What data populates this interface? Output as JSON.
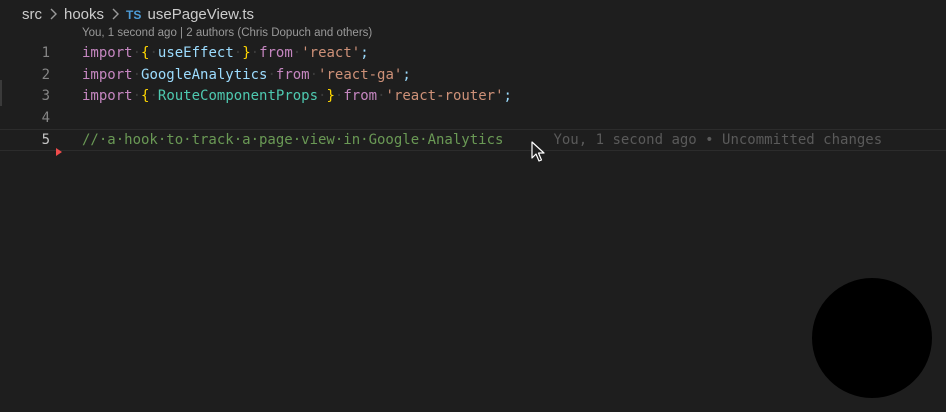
{
  "breadcrumb": {
    "items": [
      "src",
      "hooks"
    ],
    "file_icon": "TS",
    "file_name": "usePageView.ts"
  },
  "codelens": "You, 1 second ago | 2 authors (Chris Dopuch and others)",
  "line_numbers": [
    "1",
    "2",
    "3",
    "4",
    "5"
  ],
  "code": {
    "line1": {
      "kw1": "import",
      "b1": "{",
      "id": "useEffect",
      "b2": "}",
      "kw2": "from",
      "str": "'react'",
      "end": ";"
    },
    "line2": {
      "kw1": "import",
      "id": "GoogleAnalytics",
      "kw2": "from",
      "str": "'react-ga'",
      "end": ";"
    },
    "line3": {
      "kw1": "import",
      "b1": "{",
      "id": "RouteComponentProps",
      "b2": "}",
      "kw2": "from",
      "str": "'react-router'",
      "end": ";"
    },
    "line5": {
      "comment": "// a hook to track a page view in Google Analytics",
      "blame": "You, 1 second ago • Uncommitted changes"
    }
  },
  "colors": {
    "background": "#1e1e1e",
    "keyword": "#c586c0",
    "string": "#ce9178",
    "comment": "#6a9955",
    "bracket": "#ffd700",
    "type": "#4ec9b0",
    "variable": "#9cdcfe",
    "dirty_marker": "#f14c4c"
  },
  "icons": {
    "chevron": "chevron-right-icon",
    "file": "typescript-file-icon",
    "cursor": "mouse-pointer-icon",
    "gutter": "modified-line-marker-icon"
  }
}
